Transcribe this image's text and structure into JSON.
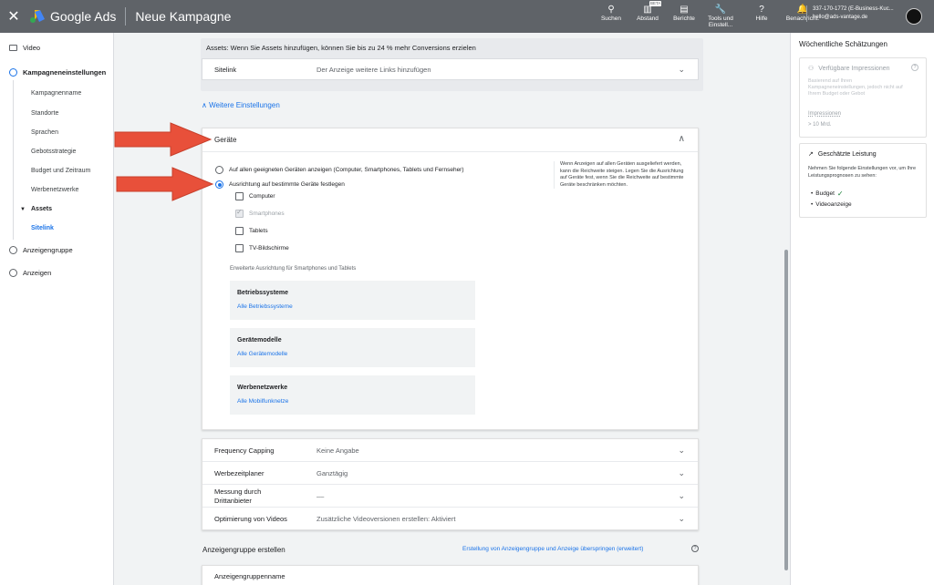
{
  "topbar": {
    "close_icon": "close-icon",
    "logo_text": "Google Ads",
    "campaign_title": "Neue Kampagne",
    "tools": [
      {
        "icon": "search-icon",
        "glyph": "⚲",
        "label": "Suchen"
      },
      {
        "icon": "abstand-icon",
        "glyph": "▥",
        "label": "Abstand",
        "badge": "BETA"
      },
      {
        "icon": "reports-icon",
        "glyph": "▤",
        "label": "Berichte"
      },
      {
        "icon": "wrench-icon",
        "glyph": "🔧",
        "label": "Tools und Einstell..."
      },
      {
        "icon": "help-icon",
        "glyph": "?",
        "label": "Hilfe"
      },
      {
        "icon": "bell-icon",
        "glyph": "🔔",
        "label": "Benachricht."
      }
    ],
    "account_line1": "337-170-1772 (E-Business-Kuc...",
    "account_line2": "hello@ads-vantage.de"
  },
  "leftnav": {
    "items": [
      {
        "label": "Video"
      },
      {
        "label": "Kampagneneinstellungen"
      },
      {
        "label": "Anzeigengruppe"
      },
      {
        "label": "Anzeigen"
      }
    ],
    "subitems": [
      "Kampagnenname",
      "Standorte",
      "Sprachen",
      "Gebotsstrategie",
      "Budget und Zeitraum",
      "Werbenetzwerke",
      "Assets",
      "Sitelink"
    ]
  },
  "main": {
    "assets_note": "Assets: Wenn Sie Assets hinzufügen, können Sie bis zu 24 % mehr Conversions erzielen",
    "sitelink_label": "Sitelink",
    "sitelink_value": "Der Anzeige weitere Links hinzufügen",
    "weitere_einstellungen": "Weitere Einstellungen",
    "geraete": {
      "title": "Geräte",
      "radio_all": "Auf allen geeigneten Geräten anzeigen (Computer, Smartphones, Tablets und Fernseher)",
      "radio_specific": "Ausrichtung auf bestimmte Geräte festlegen",
      "devices": [
        "Computer",
        "Smartphones",
        "Tablets",
        "TV-Bildschirme"
      ],
      "hint": "Wenn Anzeigen auf allen Geräten ausgeliefert werden, kann die Reichweite steigen. Legen Sie die Ausrichtung auf Geräte fest, wenn Sie die Reichweite auf bestimmte Geräte beschränken möchten.",
      "advanced_label": "Erweiterte Ausrichtung für Smartphones und Tablets",
      "advanced": [
        {
          "title": "Betriebssysteme",
          "link": "Alle Betriebssysteme"
        },
        {
          "title": "Gerätemodelle",
          "link": "Alle Gerätemodelle"
        },
        {
          "title": "Werbenetzwerke",
          "link": "Alle Mobilfunknetze"
        }
      ]
    },
    "settings_rows": [
      {
        "label": "Frequency Capping",
        "value": "Keine Angabe"
      },
      {
        "label": "Werbezeitplaner",
        "value": "Ganztägig"
      },
      {
        "label": "Messung durch Drittanbieter",
        "value": "––"
      },
      {
        "label": "Optimierung von Videos",
        "value": "Zusätzliche Videoversionen erstellen: Aktiviert"
      }
    ],
    "adgroup_section_title": "Anzeigengruppe erstellen",
    "skip_link": "Erstellung von Anzeigengruppe und Anzeige überspringen (erweitert)",
    "adgroup_name_label": "Anzeigengruppenname"
  },
  "rightpanel": {
    "title": "Wöchentliche Schätzungen",
    "impressions_head": "Verfügbare Impressionen",
    "impressions_faded": "Basierend auf Ihren Kampagneneinstellungen, jedoch nicht auf Ihrem Budget oder Gebot",
    "impressions_label": "Impressionen",
    "impressions_value": "> 10 Mrd.",
    "performance_head": "Geschätzte Leistung",
    "performance_text": "Nehmen Sie folgende Einstellungen vor, um Ihre Leistungsprognosen zu sehen:",
    "performance_items": [
      "Budget",
      "Videoanzeige"
    ]
  },
  "colors": {
    "topbar": "#5f6368",
    "accent_blue": "#1a73e8",
    "arrow_red": "#e8503a",
    "check_green": "#188038"
  }
}
